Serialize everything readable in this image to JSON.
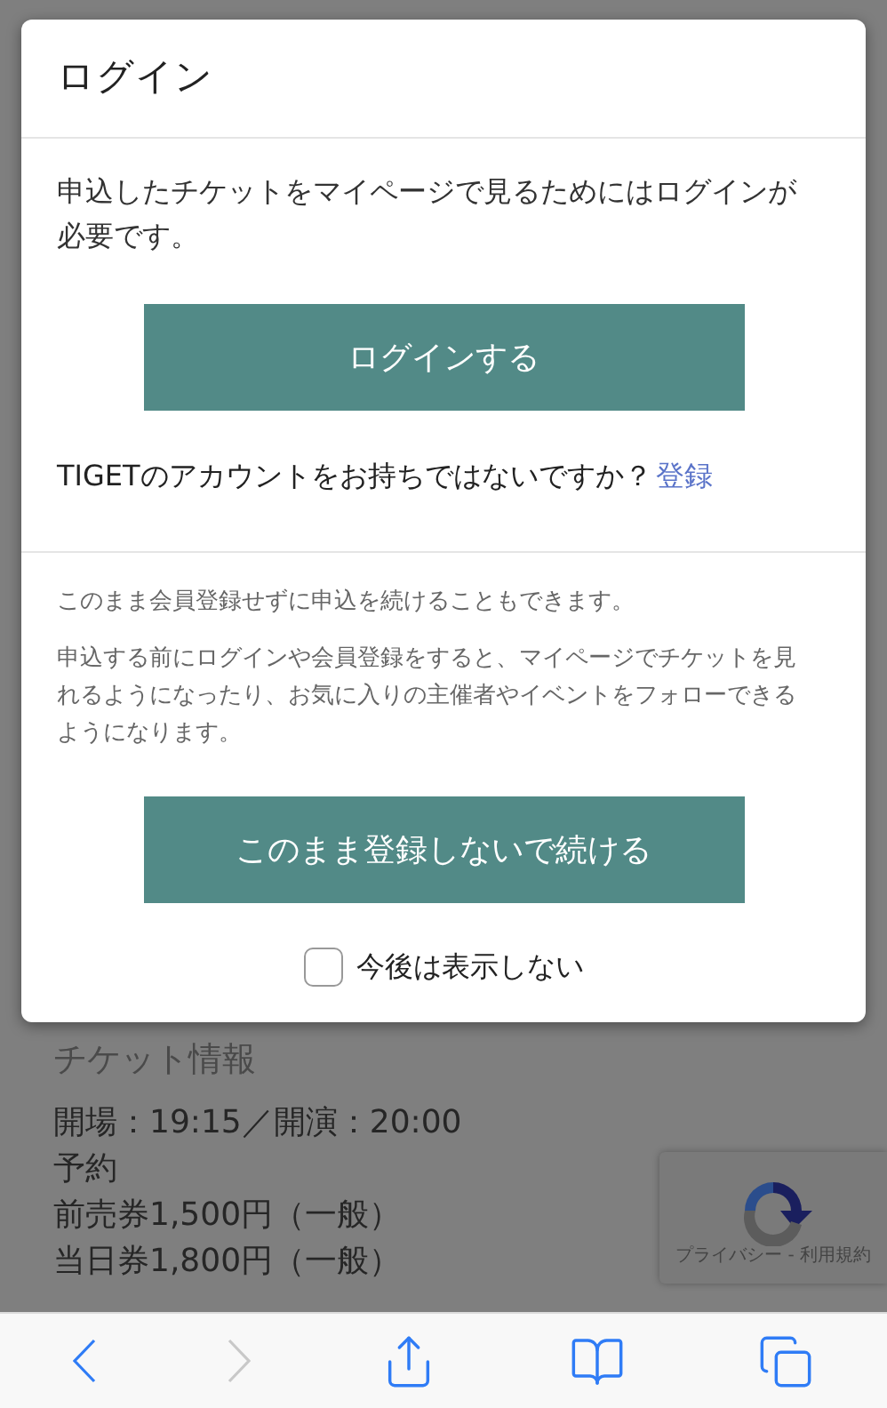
{
  "background_page": {
    "section_title": "チケット情報",
    "lines": [
      "開場：19:15／開演：20:00",
      "予約",
      "前売券1,500円（一般）",
      "当日券1,800円（一般）"
    ]
  },
  "recaptcha_badge": {
    "text": "プライバシー - 利用規約"
  },
  "modal": {
    "title": "ログイン",
    "message": "申込したチケットをマイページで見るためにはログインが必要です。",
    "login_button": "ログインする",
    "signup_prompt": "TIGETのアカウントをお持ちではないですか？",
    "signup_link": "登録",
    "guest_note": "このまま会員登録せずに申込を続けることもできます。",
    "guest_description": "申込する前にログインや会員登録をすると、マイページでチケットを見れるようになったり、お気に入りの主催者やイベントをフォローできるようになります。",
    "continue_button": "このまま登録しないで続ける",
    "dont_show_again": {
      "label": "今後は表示しない",
      "checked": false
    }
  },
  "browser_toolbar": [
    {
      "kind": "back",
      "disabled": false
    },
    {
      "kind": "forward",
      "disabled": true
    },
    {
      "kind": "share",
      "disabled": false
    },
    {
      "kind": "bookmarks",
      "disabled": false
    },
    {
      "kind": "tabs",
      "disabled": false
    }
  ]
}
